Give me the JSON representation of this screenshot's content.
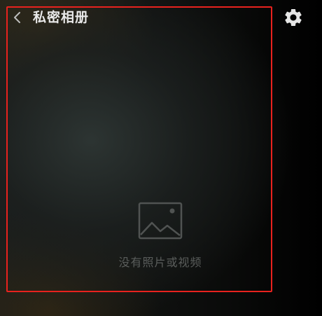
{
  "header": {
    "title": "私密相册",
    "back_icon": "chevron-left-icon",
    "settings_icon": "gear-icon"
  },
  "empty_state": {
    "icon": "image-icon",
    "message": "没有照片或视频"
  },
  "colors": {
    "highlight": "#e8221e",
    "title_text": "#e9e9e9",
    "muted_text": "#5a5d5b"
  }
}
